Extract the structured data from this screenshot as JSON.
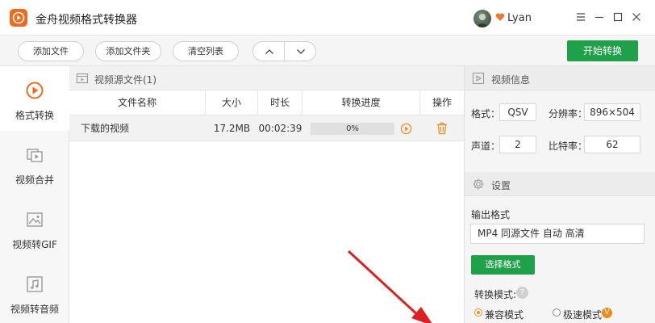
{
  "app": {
    "title": "金舟视频格式转换器",
    "username": "Lyan"
  },
  "toolbar": {
    "add_file": "添加文件",
    "add_folder": "添加文件夹",
    "clear_list": "清空列表",
    "start_convert": "开始转换"
  },
  "sidebar": {
    "items": [
      {
        "label": "格式转换",
        "icon": "play-circle-icon"
      },
      {
        "label": "视频合并",
        "icon": "video-merge-icon"
      },
      {
        "label": "视频转GIF",
        "icon": "image-icon"
      },
      {
        "label": "视频转音频",
        "icon": "music-note-icon"
      }
    ]
  },
  "file_list": {
    "section_title": "视频源文件(1)",
    "columns": [
      "文件名称",
      "大小",
      "时长",
      "转换进度",
      "操作"
    ],
    "rows": [
      {
        "name": "下载的视频",
        "size": "17.2MB",
        "duration": "00:02:39",
        "progress": "0%",
        "progress_value": 0
      }
    ]
  },
  "video_info": {
    "title": "视频信息",
    "format_label": "格式：",
    "format_value": "QSV",
    "resolution_label": "分辨率：",
    "resolution_value": "896×504",
    "channels_label": "声道：",
    "channels_value": "2",
    "bitrate_label": "比特率：",
    "bitrate_value": "62"
  },
  "settings": {
    "title": "设置",
    "output_format_label": "输出格式",
    "output_format_value": "MP4 同源文件 自动 高清",
    "select_format": "选择格式",
    "convert_mode_label": "转换模式:",
    "mode_compatible": "兼容模式",
    "mode_fast": "极速模式",
    "vip_badge": "V"
  },
  "colors": {
    "accent": "#1fa14a",
    "brand": "#f06a1c",
    "annotation": "#e02020"
  }
}
